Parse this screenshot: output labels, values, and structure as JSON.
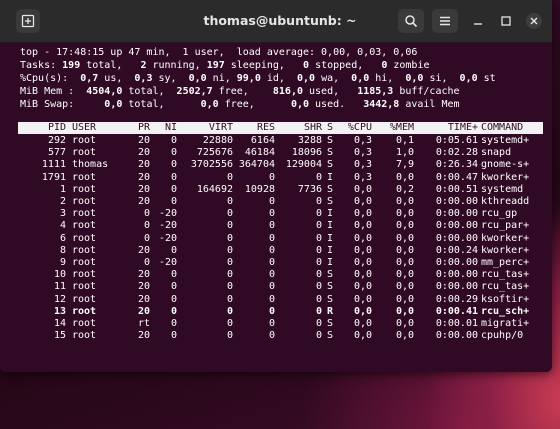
{
  "window": {
    "title": "thomas@ubuntunb: ~",
    "icons": {
      "new_tab": "new-tab-icon",
      "search": "search-icon",
      "menu": "hamburger-menu-icon",
      "minimize": "minimize-icon",
      "maximize": "maximize-icon",
      "close": "close-icon"
    }
  },
  "top": {
    "summary_lines": [
      [
        {
          "t": "top - 17:48:15 up 47 min,  1 user,  load average: 0,00, 0,03, 0,06"
        }
      ],
      [
        {
          "t": "Tasks: "
        },
        {
          "t": "199",
          "b": true
        },
        {
          "t": " total,   "
        },
        {
          "t": "2",
          "b": true
        },
        {
          "t": " running, "
        },
        {
          "t": "197",
          "b": true
        },
        {
          "t": " sleeping,   "
        },
        {
          "t": "0",
          "b": true
        },
        {
          "t": " stopped,   "
        },
        {
          "t": "0",
          "b": true
        },
        {
          "t": " zombie"
        }
      ],
      [
        {
          "t": "%Cpu(s):  "
        },
        {
          "t": "0,7",
          "b": true
        },
        {
          "t": " us,  "
        },
        {
          "t": "0,3",
          "b": true
        },
        {
          "t": " sy,  "
        },
        {
          "t": "0,0",
          "b": true
        },
        {
          "t": " ni, "
        },
        {
          "t": "99,0",
          "b": true
        },
        {
          "t": " id,  "
        },
        {
          "t": "0,0",
          "b": true
        },
        {
          "t": " wa,  "
        },
        {
          "t": "0,0",
          "b": true
        },
        {
          "t": " hi,  "
        },
        {
          "t": "0,0",
          "b": true
        },
        {
          "t": " si,  "
        },
        {
          "t": "0,0",
          "b": true
        },
        {
          "t": " st"
        }
      ],
      [
        {
          "t": "MiB Mem :  "
        },
        {
          "t": "4504,0",
          "b": true
        },
        {
          "t": " total,  "
        },
        {
          "t": "2502,7",
          "b": true
        },
        {
          "t": " free,    "
        },
        {
          "t": "816,0",
          "b": true
        },
        {
          "t": " used,   "
        },
        {
          "t": "1185,3",
          "b": true
        },
        {
          "t": " buff/cache"
        }
      ],
      [
        {
          "t": "MiB Swap:     "
        },
        {
          "t": "0,0",
          "b": true
        },
        {
          "t": " total,      "
        },
        {
          "t": "0,0",
          "b": true
        },
        {
          "t": " free,      "
        },
        {
          "t": "0,0",
          "b": true
        },
        {
          "t": " used.   "
        },
        {
          "t": "3442,8",
          "b": true
        },
        {
          "t": " avail Mem"
        }
      ]
    ],
    "columns": [
      "PID",
      "USER",
      "PR",
      "NI",
      "VIRT",
      "RES",
      "SHR",
      "S",
      "%CPU",
      "%MEM",
      "TIME+",
      "COMMAND"
    ],
    "processes": [
      {
        "pid": "292",
        "user": "root",
        "pr": "20",
        "ni": "0",
        "virt": "22880",
        "res": "6164",
        "shr": "3288",
        "s": "S",
        "cpu": "0,3",
        "mem": "0,1",
        "time": "0:05.61",
        "cmd": "systemd+",
        "bold": false
      },
      {
        "pid": "577",
        "user": "root",
        "pr": "20",
        "ni": "0",
        "virt": "725676",
        "res": "46184",
        "shr": "18096",
        "s": "S",
        "cpu": "0,3",
        "mem": "1,0",
        "time": "0:02.28",
        "cmd": "snapd",
        "bold": false
      },
      {
        "pid": "1111",
        "user": "thomas",
        "pr": "20",
        "ni": "0",
        "virt": "3702556",
        "res": "364704",
        "shr": "129004",
        "s": "S",
        "cpu": "0,3",
        "mem": "7,9",
        "time": "0:26.34",
        "cmd": "gnome-s+",
        "bold": false
      },
      {
        "pid": "1791",
        "user": "root",
        "pr": "20",
        "ni": "0",
        "virt": "0",
        "res": "0",
        "shr": "0",
        "s": "I",
        "cpu": "0,3",
        "mem": "0,0",
        "time": "0:00.47",
        "cmd": "kworker+",
        "bold": false
      },
      {
        "pid": "1",
        "user": "root",
        "pr": "20",
        "ni": "0",
        "virt": "164692",
        "res": "10928",
        "shr": "7736",
        "s": "S",
        "cpu": "0,0",
        "mem": "0,2",
        "time": "0:00.51",
        "cmd": "systemd",
        "bold": false
      },
      {
        "pid": "2",
        "user": "root",
        "pr": "20",
        "ni": "0",
        "virt": "0",
        "res": "0",
        "shr": "0",
        "s": "S",
        "cpu": "0,0",
        "mem": "0,0",
        "time": "0:00.00",
        "cmd": "kthreadd",
        "bold": false
      },
      {
        "pid": "3",
        "user": "root",
        "pr": "0",
        "ni": "-20",
        "virt": "0",
        "res": "0",
        "shr": "0",
        "s": "I",
        "cpu": "0,0",
        "mem": "0,0",
        "time": "0:00.00",
        "cmd": "rcu_gp",
        "bold": false
      },
      {
        "pid": "4",
        "user": "root",
        "pr": "0",
        "ni": "-20",
        "virt": "0",
        "res": "0",
        "shr": "0",
        "s": "I",
        "cpu": "0,0",
        "mem": "0,0",
        "time": "0:00.00",
        "cmd": "rcu_par+",
        "bold": false
      },
      {
        "pid": "6",
        "user": "root",
        "pr": "0",
        "ni": "-20",
        "virt": "0",
        "res": "0",
        "shr": "0",
        "s": "I",
        "cpu": "0,0",
        "mem": "0,0",
        "time": "0:00.00",
        "cmd": "kworker+",
        "bold": false
      },
      {
        "pid": "8",
        "user": "root",
        "pr": "20",
        "ni": "0",
        "virt": "0",
        "res": "0",
        "shr": "0",
        "s": "I",
        "cpu": "0,0",
        "mem": "0,0",
        "time": "0:00.24",
        "cmd": "kworker+",
        "bold": false
      },
      {
        "pid": "9",
        "user": "root",
        "pr": "0",
        "ni": "-20",
        "virt": "0",
        "res": "0",
        "shr": "0",
        "s": "I",
        "cpu": "0,0",
        "mem": "0,0",
        "time": "0:00.00",
        "cmd": "mm_perc+",
        "bold": false
      },
      {
        "pid": "10",
        "user": "root",
        "pr": "20",
        "ni": "0",
        "virt": "0",
        "res": "0",
        "shr": "0",
        "s": "S",
        "cpu": "0,0",
        "mem": "0,0",
        "time": "0:00.00",
        "cmd": "rcu_tas+",
        "bold": false
      },
      {
        "pid": "11",
        "user": "root",
        "pr": "20",
        "ni": "0",
        "virt": "0",
        "res": "0",
        "shr": "0",
        "s": "S",
        "cpu": "0,0",
        "mem": "0,0",
        "time": "0:00.00",
        "cmd": "rcu_tas+",
        "bold": false
      },
      {
        "pid": "12",
        "user": "root",
        "pr": "20",
        "ni": "0",
        "virt": "0",
        "res": "0",
        "shr": "0",
        "s": "S",
        "cpu": "0,0",
        "mem": "0,0",
        "time": "0:00.29",
        "cmd": "ksoftir+",
        "bold": false
      },
      {
        "pid": "13",
        "user": "root",
        "pr": "20",
        "ni": "0",
        "virt": "0",
        "res": "0",
        "shr": "0",
        "s": "R",
        "cpu": "0,0",
        "mem": "0,0",
        "time": "0:00.41",
        "cmd": "rcu_sch+",
        "bold": true
      },
      {
        "pid": "14",
        "user": "root",
        "pr": "rt",
        "ni": "0",
        "virt": "0",
        "res": "0",
        "shr": "0",
        "s": "S",
        "cpu": "0,0",
        "mem": "0,0",
        "time": "0:00.01",
        "cmd": "migrati+",
        "bold": false
      },
      {
        "pid": "15",
        "user": "root",
        "pr": "20",
        "ni": "0",
        "virt": "0",
        "res": "0",
        "shr": "0",
        "s": "S",
        "cpu": "0,0",
        "mem": "0,0",
        "time": "0:00.00",
        "cmd": "cpuhp/0",
        "bold": false
      }
    ]
  }
}
